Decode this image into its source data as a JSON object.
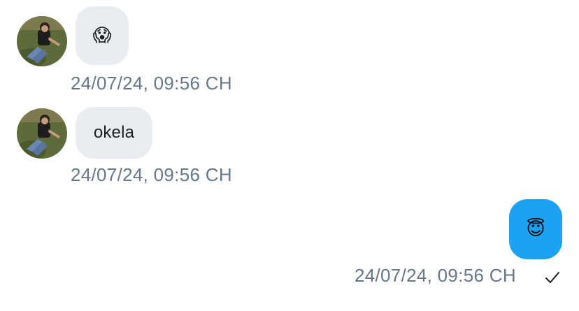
{
  "messages": [
    {
      "direction": "incoming",
      "avatar_icon": "user-photo-avatar",
      "content_type": "emoji",
      "emoji": "😱",
      "timestamp": "24/07/24, 09:56 CH"
    },
    {
      "direction": "incoming",
      "avatar_icon": "user-photo-avatar",
      "content_type": "text",
      "text": "okela",
      "timestamp": "24/07/24, 09:56 CH"
    },
    {
      "direction": "outgoing",
      "content_type": "emoji",
      "emoji": "😇",
      "timestamp": "24/07/24, 09:56 CH",
      "status_icon": "checkmark-icon"
    }
  ],
  "colors": {
    "incoming_bubble": "#e9edf1",
    "outgoing_bubble": "#1da1f2",
    "timestamp_text": "#66778a",
    "body_text": "#1b1f24"
  }
}
